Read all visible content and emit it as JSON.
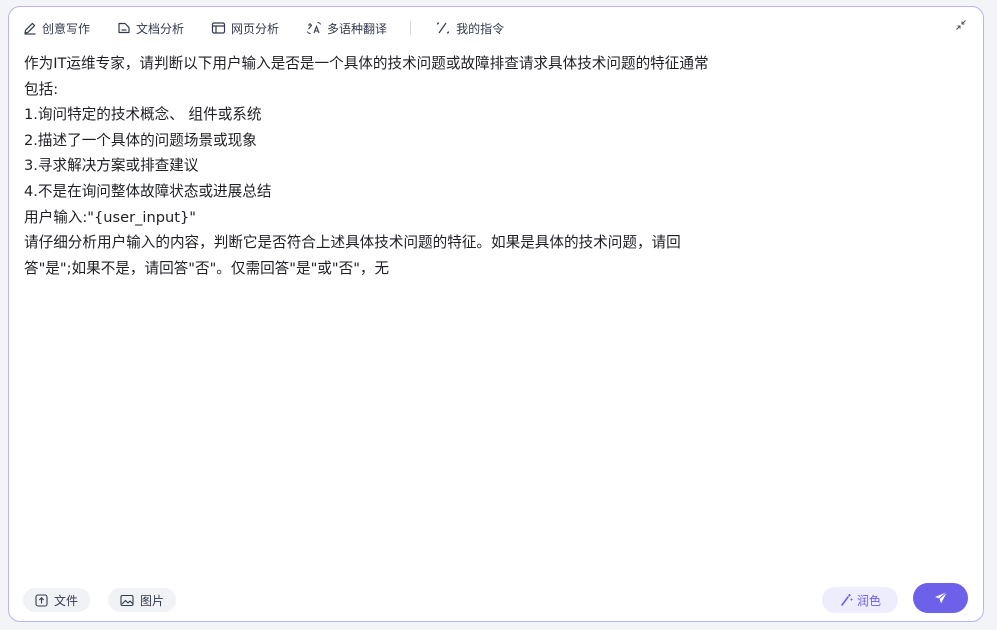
{
  "toolbar": {
    "items": [
      {
        "label": "创意写作",
        "icon": "pen-icon"
      },
      {
        "label": "文档分析",
        "icon": "document-icon"
      },
      {
        "label": "网页分析",
        "icon": "webpage-icon"
      },
      {
        "label": "多语种翻译",
        "icon": "translate-icon"
      },
      {
        "label": "我的指令",
        "icon": "command-icon"
      }
    ],
    "collapse_icon": "collapse-arrows-icon"
  },
  "content": {
    "lines": [
      "作为IT运维专家，请判断以下用户输入是否是一个具体的技术问题或故障排查请求具体技术问题的特征通常",
      "包括:",
      "1.询问特定的技术概念、 组件或系统",
      "2.描述了一个具体的问题场景或现象",
      "3.寻求解决方案或排查建议",
      "4.不是在询问整体故障状态或进展总结",
      "用户输入:\"{user_input}\"",
      "请仔细分析用户输入的内容，判断它是否符合上述具体技术问题的特征。如果是具体的技术问题，请回",
      "答\"是\";如果不是，请回答\"否\"。仅需回答\"是\"或\"否\"，无"
    ]
  },
  "bottom": {
    "file_label": "文件",
    "image_label": "图片",
    "polish_label": "润色",
    "send_icon": "send-icon"
  },
  "colors": {
    "accent": "#6d61ea",
    "border": "#b9b4f2",
    "text": "#1e1f24"
  }
}
